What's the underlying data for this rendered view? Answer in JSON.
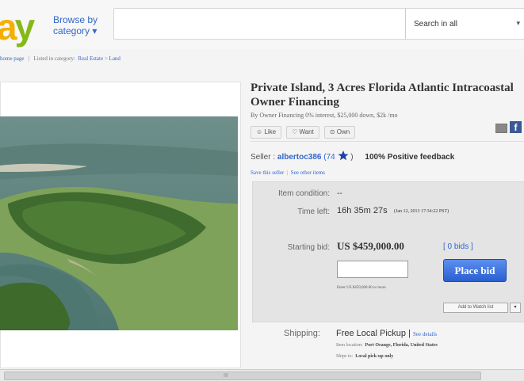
{
  "header": {
    "logo": {
      "a": "a",
      "y": "y"
    },
    "browse": {
      "line1": "Browse by",
      "line2": "category ▾"
    },
    "search": {
      "placeholder": "",
      "category": "Search in all",
      "caret": "▾"
    }
  },
  "breadcrumb": {
    "home": "home page",
    "sep": "|",
    "listed_in": "Listed in category:",
    "cat1": "Real Estate",
    "arrow": ">",
    "cat2": "Land"
  },
  "listing": {
    "title_line1": "Private Island, 3 Acres Florida Atlantic Intracoastal",
    "title_line2": "Owner Financing",
    "subtitle": "By Owner Financing 0% interest, $25,000 down, $2k /mo",
    "social": {
      "like": "☺ Like",
      "want": "♡ Want",
      "own": "⊙ Own"
    },
    "fb": "f"
  },
  "seller": {
    "label": "Seller :",
    "name": "albertoc386",
    "score": "(74",
    "close": ")",
    "positive": "100% Positive feedback",
    "save": "Save this seller",
    "sep": "|",
    "other": "See other items"
  },
  "bidbox": {
    "condition_label": "Item condition:",
    "condition_value": "--",
    "time_label": "Time left:",
    "time_value": "16h 35m 27s",
    "time_detail": "(Jan 12, 2013  17:34:22 PST)",
    "bid_label": "Starting bid:",
    "bid_value": "US $459,000.00",
    "bids": "[ 0 bids ]",
    "place_bid": "Place bid",
    "enter_hint": "Enter US $459,000.00 or more",
    "watch": "Add to Watch list",
    "watch_caret": "▾"
  },
  "shipping": {
    "label": "Shipping:",
    "value": "Free Local Pickup |",
    "see": "See details",
    "loc_label": "Item location:",
    "loc_value": "Port Orange, Florida, United States",
    "ship_label": "Ships to:",
    "ship_value": "Local pick-up only"
  },
  "scrollbar": {
    "grip": "III"
  },
  "colors": {
    "link": "#3366cc",
    "logo_yellow": "#f5af02",
    "logo_green": "#86b817",
    "place_bid": "#2a5fd1",
    "facebook": "#3b5998"
  }
}
